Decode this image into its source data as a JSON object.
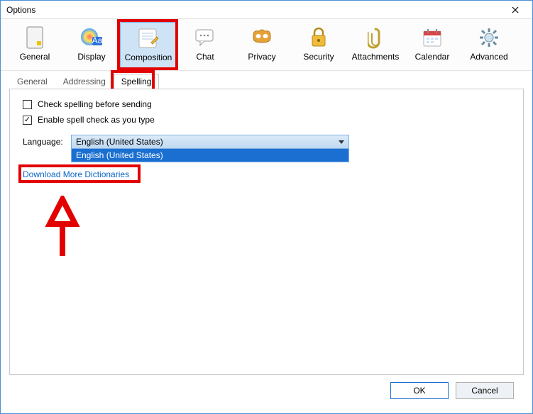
{
  "window": {
    "title": "Options"
  },
  "categories": [
    {
      "key": "general",
      "label": "General"
    },
    {
      "key": "display",
      "label": "Display"
    },
    {
      "key": "composition",
      "label": "Composition",
      "selected": true
    },
    {
      "key": "chat",
      "label": "Chat"
    },
    {
      "key": "privacy",
      "label": "Privacy"
    },
    {
      "key": "security",
      "label": "Security"
    },
    {
      "key": "attachments",
      "label": "Attachments"
    },
    {
      "key": "calendar",
      "label": "Calendar"
    },
    {
      "key": "advanced",
      "label": "Advanced"
    }
  ],
  "subtabs": [
    {
      "label": "General"
    },
    {
      "label": "Addressing"
    },
    {
      "label": "Spelling",
      "active": true
    }
  ],
  "spelling": {
    "check_before_sending_label": "Check spelling before sending",
    "check_before_sending_checked": false,
    "enable_as_you_type_label": "Enable spell check as you type",
    "enable_as_you_type_checked": true,
    "language_label": "Language:",
    "selected_language": "English (United States)",
    "dropdown_option": "English (United States)",
    "download_more_label": "Download More Dictionaries"
  },
  "buttons": {
    "ok": "OK",
    "cancel": "Cancel"
  }
}
